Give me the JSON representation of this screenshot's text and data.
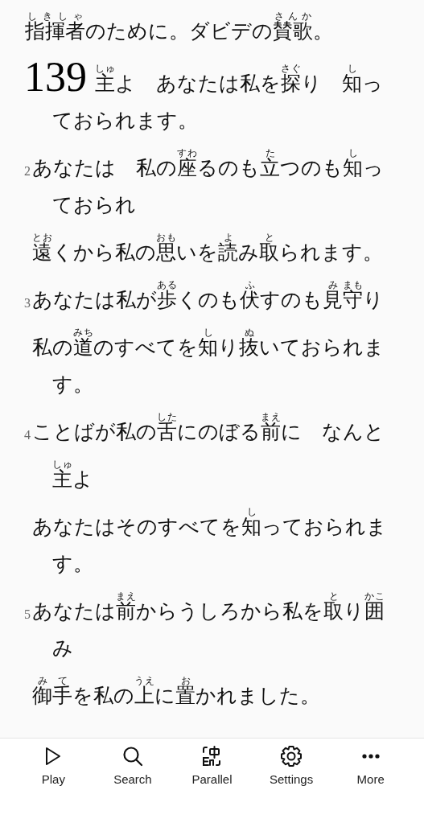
{
  "heading": [
    {
      "base": "指揮者",
      "ruby": "しきしゃ"
    },
    "のために。ダビデの",
    {
      "base": "賛歌",
      "ruby": "さんか"
    },
    "。"
  ],
  "verses": [
    {
      "number": "139",
      "kind": "chapter",
      "lines": [
        [
          [
            {
              "base": "主",
              "ruby": "しゅ"
            },
            "よ　あなたは私を",
            {
              "base": "探",
              "ruby": "さぐ"
            },
            "り　",
            {
              "base": "知",
              "ruby": "し"
            },
            "っ"
          ],
          [
            "ておられます。"
          ]
        ]
      ]
    },
    {
      "number": "2",
      "kind": "verse",
      "lines": [
        [
          [
            "あなたは　私の",
            {
              "base": "座",
              "ruby": "すわ"
            },
            "るのも",
            {
              "base": "立",
              "ruby": "た"
            },
            "つのも",
            {
              "base": "知",
              "ruby": "し"
            },
            "っ"
          ],
          [
            "ておられ"
          ]
        ],
        [
          [
            {
              "base": "遠",
              "ruby": "とお"
            },
            "くから私の",
            {
              "base": "思",
              "ruby": "おも"
            },
            "いを",
            {
              "base": "読",
              "ruby": "よ"
            },
            "み",
            {
              "base": "取",
              "ruby": "と"
            },
            "られます。"
          ]
        ]
      ]
    },
    {
      "number": "3",
      "kind": "verse",
      "lines": [
        [
          [
            "あなたは私が",
            {
              "base": "歩",
              "ruby": "ある"
            },
            "くのも",
            {
              "base": "伏",
              "ruby": "ふ"
            },
            "すのも",
            {
              "base": "見",
              "ruby": "み"
            },
            {
              "base": "守",
              "ruby": "まも"
            },
            "り"
          ]
        ],
        [
          [
            "私の",
            {
              "base": "道",
              "ruby": "みち"
            },
            "のすべてを",
            {
              "base": "知",
              "ruby": "し"
            },
            "り",
            {
              "base": "抜",
              "ruby": "ぬ"
            },
            "いておられま"
          ],
          [
            "す。"
          ]
        ]
      ]
    },
    {
      "number": "4",
      "kind": "verse",
      "lines": [
        [
          [
            "ことばが私の",
            {
              "base": "舌",
              "ruby": "した"
            },
            "にのぼる",
            {
              "base": "前",
              "ruby": "まえ"
            },
            "に　なんと"
          ],
          [
            {
              "base": "主",
              "ruby": "しゅ"
            },
            "よ"
          ]
        ],
        [
          [
            "あなたはそのすべてを",
            {
              "base": "知",
              "ruby": "し"
            },
            "っておられま"
          ],
          [
            "す。"
          ]
        ]
      ]
    },
    {
      "number": "5",
      "kind": "verse",
      "lines": [
        [
          [
            "あなたは",
            {
              "base": "前",
              "ruby": "まえ"
            },
            "からうしろから私を",
            {
              "base": "取",
              "ruby": "と"
            },
            "り",
            {
              "base": "囲",
              "ruby": "かこ"
            }
          ],
          [
            "み"
          ]
        ],
        [
          [
            {
              "base": "御",
              "ruby": "み"
            },
            {
              "base": "手",
              "ruby": "て"
            },
            "を私の",
            {
              "base": "上",
              "ruby": "うえ"
            },
            "に",
            {
              "base": "置",
              "ruby": "お"
            },
            "かれました。"
          ]
        ]
      ]
    }
  ],
  "toolbar": [
    {
      "kind": "play",
      "label": "Play"
    },
    {
      "kind": "search",
      "label": "Search"
    },
    {
      "kind": "parallel",
      "label": "Parallel"
    },
    {
      "kind": "settings",
      "label": "Settings"
    },
    {
      "kind": "more",
      "label": "More"
    }
  ]
}
